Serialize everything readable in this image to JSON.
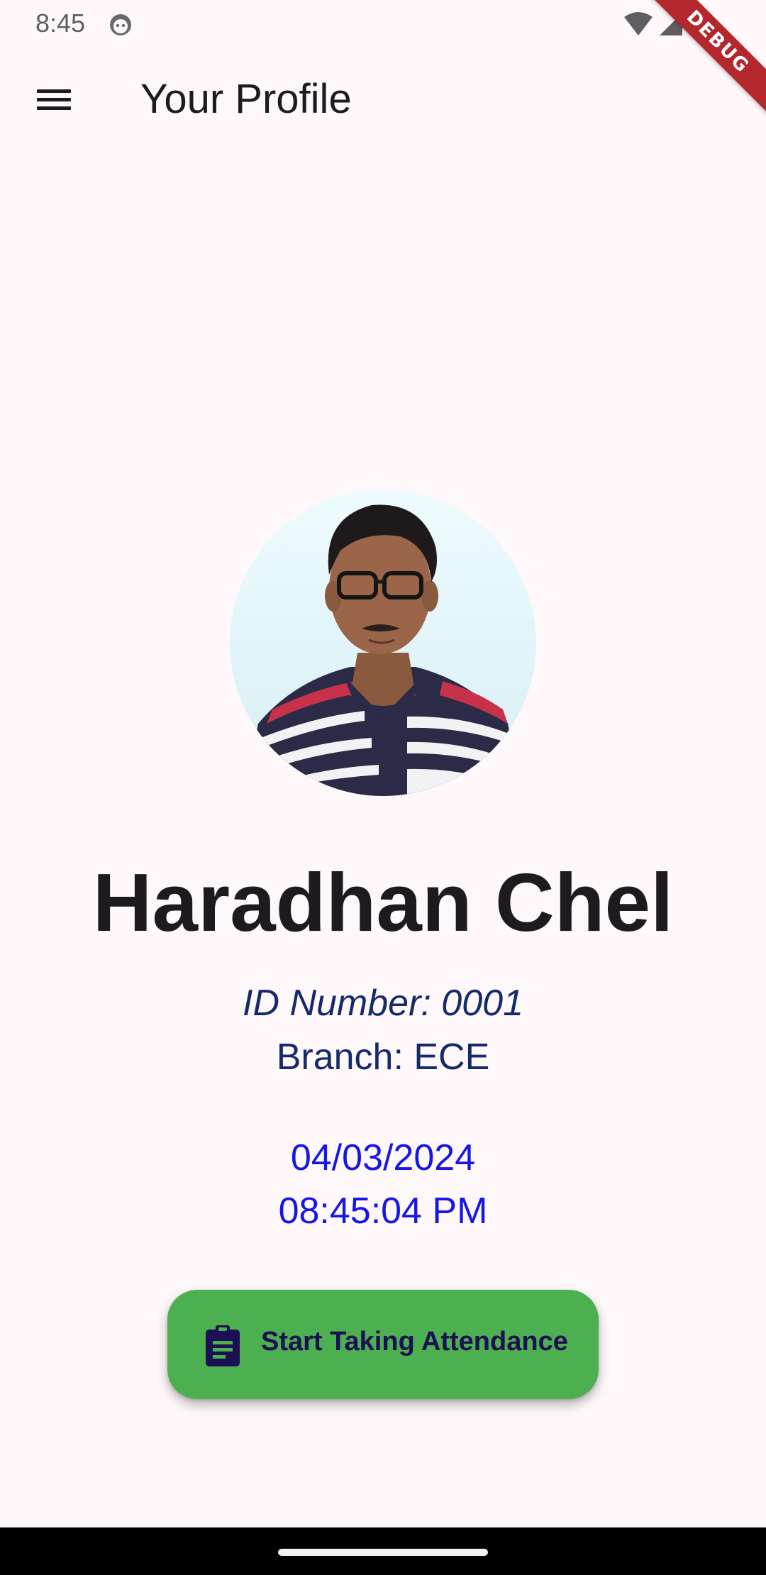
{
  "status_bar": {
    "time": "8:45",
    "icons": [
      "face-icon",
      "wifi-icon",
      "signal-icon",
      "battery-icon"
    ]
  },
  "debug_banner": {
    "label": "DEBUG",
    "color": "#b3272d"
  },
  "app_bar": {
    "title": "Your Profile",
    "menu_icon": "hamburger-menu-icon"
  },
  "profile": {
    "name": "Haradhan Chel",
    "id_number": "ID Number: 0001",
    "branch": "Branch: ECE",
    "date": "04/03/2024",
    "time": "08:45:04 PM"
  },
  "action": {
    "label": "Start Taking Attendance",
    "icon": "clipboard-icon",
    "color": "#4caf50"
  },
  "colors": {
    "background": "#fef8fb",
    "text_primary": "#1d1b20",
    "info_text": "#152a68",
    "datetime_text": "#1616e6"
  }
}
